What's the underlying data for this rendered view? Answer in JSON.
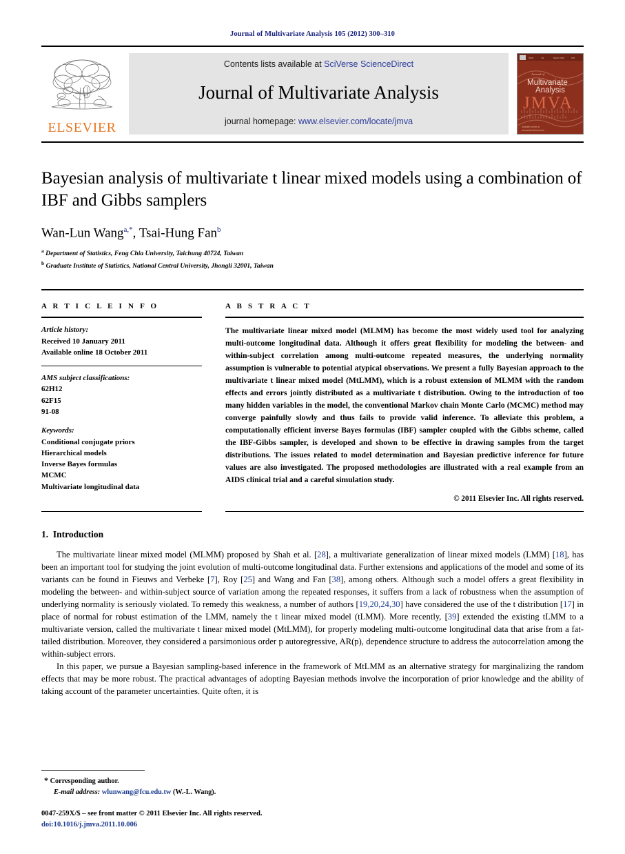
{
  "running_head": "Journal of Multivariate Analysis 105 (2012) 300–310",
  "masthead": {
    "publisher_name": "ELSEVIER",
    "contents_prefix": "Contents lists available at ",
    "contents_link": "SciVerse ScienceDirect",
    "journal_title": "Journal of Multivariate Analysis",
    "homepage_prefix": "journal homepage: ",
    "homepage_link": "www.elsevier.com/locate/jmva",
    "cover": {
      "kicker": "Journal of",
      "line1": "Multivariate",
      "line2": "Analysis",
      "acronym": "JMVA",
      "bg_color": "#8c2f1c",
      "accent_color": "#e8b9a6"
    }
  },
  "article": {
    "title": "Bayesian analysis of multivariate t linear mixed models using a combination of IBF and Gibbs samplers",
    "authors": [
      {
        "name": "Wan-Lun Wang",
        "sup": "a,*"
      },
      {
        "name": "Tsai-Hung Fan",
        "sup": "b"
      }
    ],
    "affiliations": [
      {
        "mark": "a",
        "text": "Department of Statistics, Feng Chia University, Taichung 40724, Taiwan"
      },
      {
        "mark": "b",
        "text": "Graduate Institute of Statistics, National Central University, Jhongli 32001, Taiwan"
      }
    ]
  },
  "info": {
    "heading": "A R T I C L E   I N F O",
    "history_label": "Article history:",
    "history": [
      "Received 10 January 2011",
      "Available online 18 October 2011"
    ],
    "ams_label": "AMS subject classifications:",
    "ams": [
      "62H12",
      "62F15",
      "91-08"
    ],
    "keywords_label": "Keywords:",
    "keywords": [
      "Conditional conjugate priors",
      "Hierarchical models",
      "Inverse Bayes formulas",
      "MCMC",
      "Multivariate longitudinal data"
    ]
  },
  "abstract": {
    "heading": "A B S T R A C T",
    "text": "The multivariate linear mixed model (MLMM) has become the most widely used tool for analyzing multi-outcome longitudinal data. Although it offers great flexibility for modeling the between- and within-subject correlation among multi-outcome repeated measures, the underlying normality assumption is vulnerable to potential atypical observations. We present a fully Bayesian approach to the multivariate t linear mixed model (MtLMM), which is a robust extension of MLMM with the random effects and errors jointly distributed as a multivariate t distribution. Owing to the introduction of too many hidden variables in the model, the conventional Markov chain Monte Carlo (MCMC) method may converge painfully slowly and thus fails to provide valid inference. To alleviate this problem, a computationally efficient inverse Bayes formulas (IBF) sampler coupled with the Gibbs scheme, called the IBF-Gibbs sampler, is developed and shown to be effective in drawing samples from the target distributions. The issues related to model determination and Bayesian predictive inference for future values are also investigated. The proposed methodologies are illustrated with a real example from an AIDS clinical trial and a careful simulation study.",
    "copyright": "© 2011 Elsevier Inc. All rights reserved."
  },
  "section": {
    "number": "1.",
    "title": "Introduction"
  },
  "paragraphs": {
    "p1_a": "The multivariate linear mixed model (MLMM) proposed by Shah et al. [",
    "p1_r1": "28",
    "p1_b": "], a multivariate generalization of linear mixed models (LMM) [",
    "p1_r2": "18",
    "p1_c": "], has been an important tool for studying the joint evolution of multi-outcome longitudinal data. Further extensions and applications of the model and some of its variants can be found in Fieuws and Verbeke [",
    "p1_r3": "7",
    "p1_d": "], Roy [",
    "p1_r4": "25",
    "p1_e": "] and Wang and Fan [",
    "p1_r5": "38",
    "p1_f": "], among others. Although such a model offers a great flexibility in modeling the between- and within-subject source of variation among the repeated responses, it suffers from a lack of robustness when the assumption of underlying normality is seriously violated. To remedy this weakness, a number of authors [",
    "p1_r6": "19,20,24,30",
    "p1_g": "] have considered the use of the t distribution [",
    "p1_r7": "17",
    "p1_h": "] in place of normal for robust estimation of the LMM, namely the t linear mixed model (tLMM). More recently, [",
    "p1_r8": "39",
    "p1_i": "] extended the existing tLMM to a multivariate version, called the multivariate t linear mixed model (MtLMM), for properly modeling multi-outcome longitudinal data that arise from a fat-tailed distribution. Moreover, they considered a parsimonious order p autoregressive, AR(p), dependence structure to address the autocorrelation among the within-subject errors.",
    "p2": "In this paper, we pursue a Bayesian sampling-based inference in the framework of MtLMM as an alternative strategy for marginalizing the random effects that may be more robust. The practical advantages of adopting Bayesian methods involve the incorporation of prior knowledge and the ability of taking account of the parameter uncertainties. Quite often, it is"
  },
  "footnote": {
    "star": "*",
    "corresponding": "Corresponding author.",
    "email_label": "E-mail address:",
    "email": "wlunwang@fcu.edu.tw",
    "email_suffix": "(W.-L. Wang).",
    "issn_line": "0047-259X/$ – see front matter © 2011 Elsevier Inc. All rights reserved.",
    "doi": "doi:10.1016/j.jmva.2011.10.006"
  }
}
